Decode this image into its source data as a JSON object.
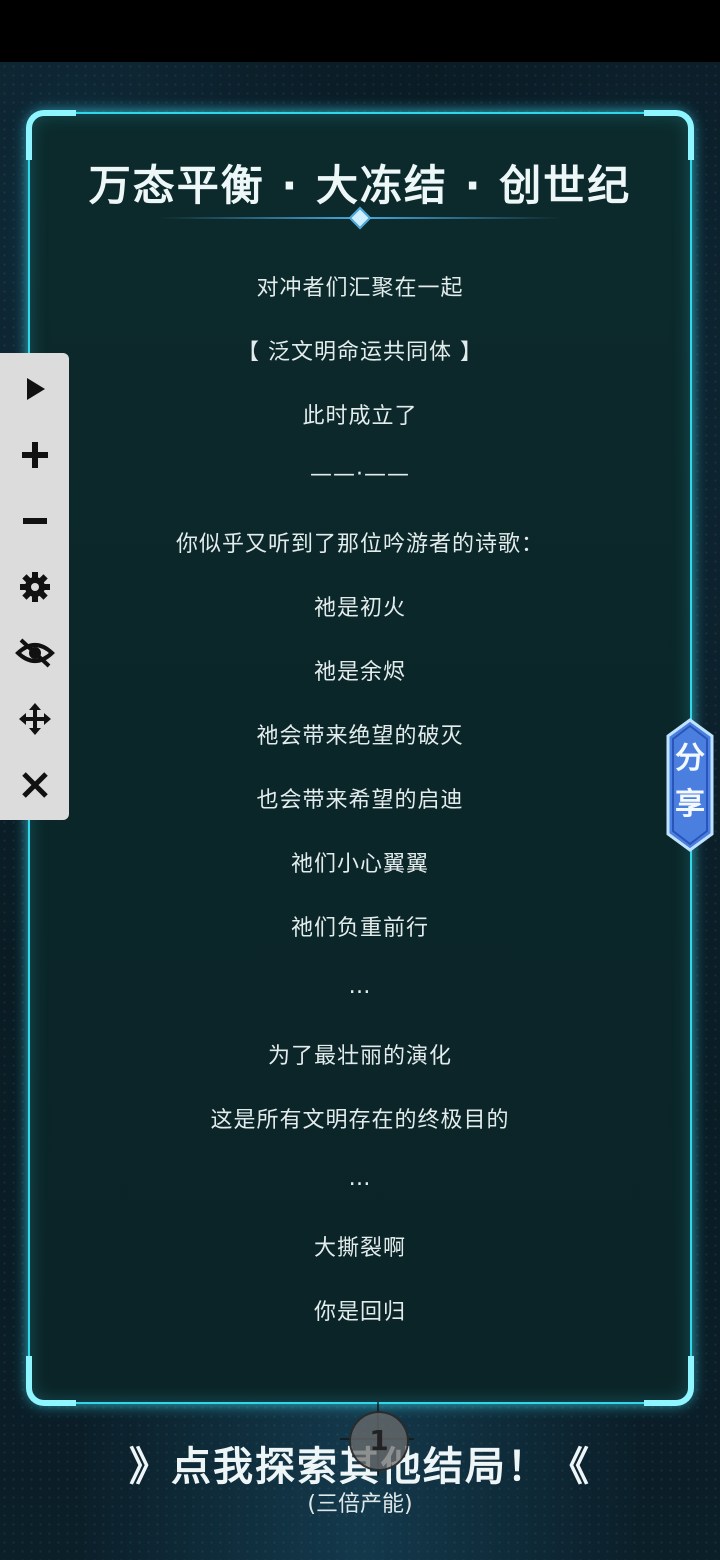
{
  "panel": {
    "title": "万态平衡 · 大冻结 · 创世纪",
    "lines": [
      "对冲者们汇聚在一起",
      "【 泛文明命运共同体 】",
      "此时成立了",
      "——·——",
      "你似乎又听到了那位吟游者的诗歌：",
      "祂是初火",
      "祂是余烬",
      "祂会带来绝望的破灭",
      "也会带来希望的启迪",
      "祂们小心翼翼",
      "祂们负重前行",
      "…",
      "为了最壮丽的演化",
      "这是所有文明存在的终极目的",
      "…",
      "大撕裂啊",
      "你是回归"
    ]
  },
  "toolbar": {
    "items": [
      "play-icon",
      "plus-icon",
      "minus-icon",
      "gear-icon",
      "eye-off-icon",
      "move-icon",
      "close-icon"
    ]
  },
  "share": {
    "label": "分享",
    "char1": "分",
    "char2": "享"
  },
  "footer": {
    "cta": "》点我探索其他结局！《",
    "sub": "(三倍产能)",
    "badge": "1"
  },
  "colors": {
    "accent": "#2fd7ec",
    "panel": "#0b2628",
    "text": "#e3ecec"
  }
}
